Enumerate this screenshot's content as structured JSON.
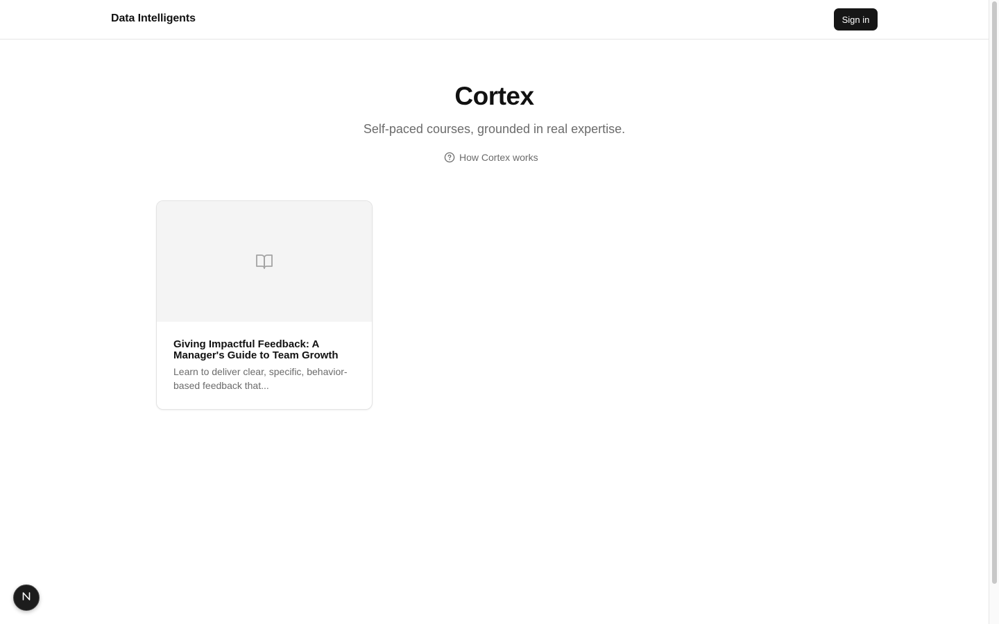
{
  "header": {
    "brand": "Data Intelligents",
    "signin_label": "Sign in"
  },
  "hero": {
    "title": "Cortex",
    "subtitle": "Self-paced courses, grounded in real expertise.",
    "how_link_label": "How Cortex works",
    "how_link_icon": "help-circle-icon"
  },
  "courses": [
    {
      "title": "Giving Impactful Feedback: A Manager's Guide to Team Growth",
      "description": "Learn to deliver clear, specific, behavior-based feedback that...",
      "icon": "book-open-icon"
    }
  ],
  "floating_badge": {
    "icon": "n-logo-icon"
  },
  "colors": {
    "primary_button": "#161616",
    "muted_text": "#6b6b6b",
    "card_media_bg": "#f4f4f4",
    "border": "#e5e5e5"
  }
}
